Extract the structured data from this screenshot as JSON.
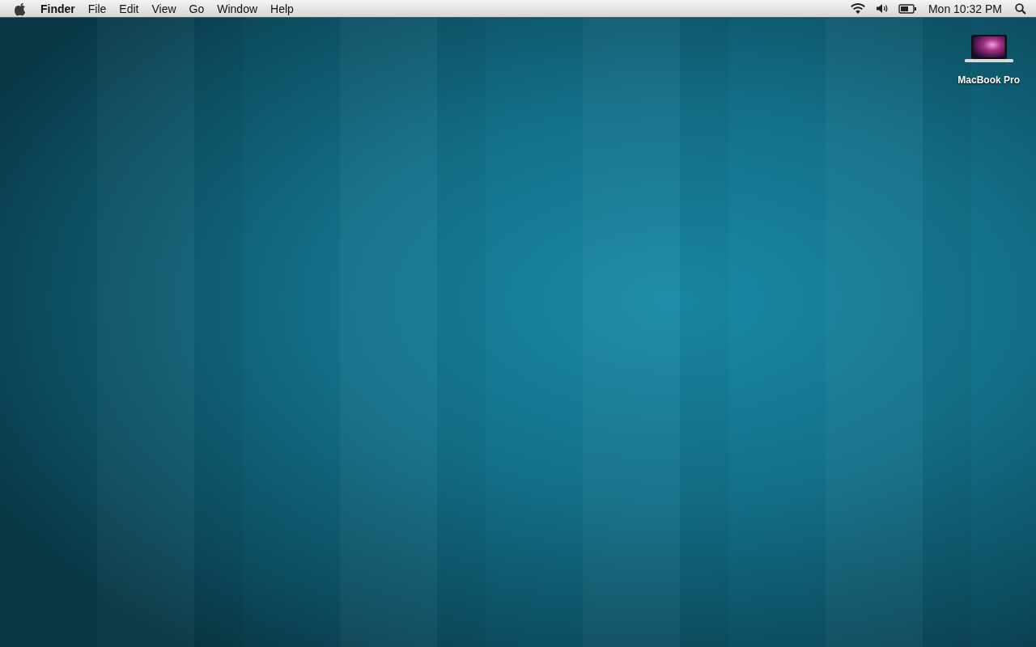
{
  "menu_bar": {
    "app_name": "Finder",
    "menus": [
      "File",
      "Edit",
      "View",
      "Go",
      "Window",
      "Help"
    ],
    "clock": "Mon 10:32 PM"
  },
  "desktop_icons": [
    {
      "label": "MacBook Pro"
    }
  ]
}
